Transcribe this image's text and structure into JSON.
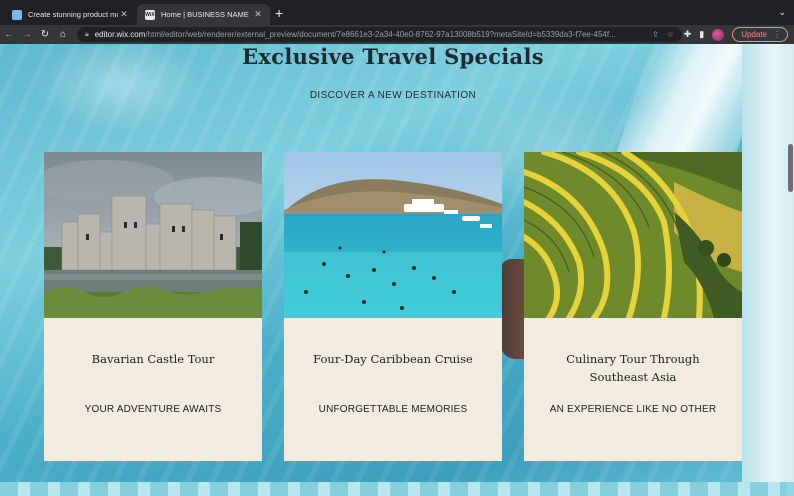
{
  "browser": {
    "tabs": [
      {
        "title": "Create stunning product mock",
        "active": false,
        "favicon": "mockup-favicon"
      },
      {
        "title": "Home | BUSINESS NAME",
        "active": true,
        "favicon": "wix-favicon"
      }
    ],
    "url_host": "editor.wix.com",
    "url_path": "/html/editor/web/renderer/external_preview/document/7e8661e3-2a34-40e0-8762-97a13008b519?metaSiteId=b5339da3-f7ee-454f...",
    "update_label": "Update",
    "wix_favicon_text": "WiX"
  },
  "page": {
    "headline": "Exclusive Travel Specials",
    "subheadline": "DISCOVER A NEW DESTINATION",
    "cards": [
      {
        "title": "Bavarian Castle Tour",
        "tagline": "YOUR ADVENTURE AWAITS",
        "image": "castle-photo"
      },
      {
        "title": "Four-Day Caribbean Cruise",
        "tagline": "UNFORGETTABLE MEMORIES",
        "image": "caribbean-photo"
      },
      {
        "title": "Culinary Tour Through Southeast Asia",
        "tagline": "AN EXPERIENCE LIKE NO OTHER",
        "image": "rice-terrace-photo"
      }
    ]
  },
  "colors": {
    "card_background": "#f1ebe0",
    "text_dark": "#1f2a30",
    "update_accent": "#f28b82"
  }
}
